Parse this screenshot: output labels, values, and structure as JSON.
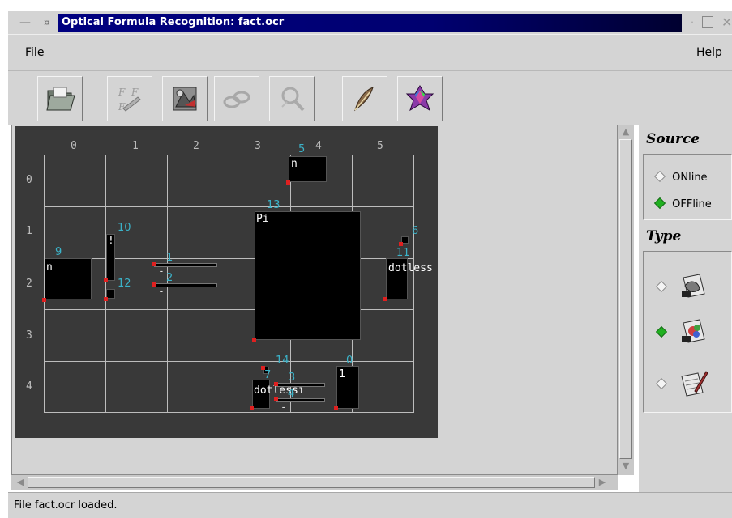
{
  "window": {
    "title": "Optical Formula Recognition: fact.ocr"
  },
  "menu": {
    "file": "File",
    "help": "Help"
  },
  "toolbar": {
    "buttons": [
      {
        "icon": "open-folder-icon"
      },
      {
        "icon": "formula-pencil-icon"
      },
      {
        "icon": "recognize-icon"
      },
      {
        "icon": "link-icon"
      },
      {
        "icon": "magnifier-icon"
      },
      {
        "icon": "feather-icon"
      },
      {
        "icon": "polyhedron-icon"
      }
    ]
  },
  "grid": {
    "columns": [
      "0",
      "1",
      "2",
      "3",
      "4",
      "5"
    ],
    "rows": [
      "0",
      "1",
      "2",
      "3",
      "4"
    ]
  },
  "glyphs": [
    {
      "id": "5",
      "label": "n"
    },
    {
      "id": "13",
      "label": "Pi"
    },
    {
      "id": "9",
      "label": "n"
    },
    {
      "id": "10",
      "label": "!"
    },
    {
      "id": "12",
      "label": ""
    },
    {
      "id": "1",
      "label": "-"
    },
    {
      "id": "2",
      "label": "-"
    },
    {
      "id": "6",
      "label": ""
    },
    {
      "id": "11",
      "label": "dotless"
    },
    {
      "id": "14",
      "label": ""
    },
    {
      "id": "7",
      "label": "dotlessi"
    },
    {
      "id": "3",
      "label": ""
    },
    {
      "id": "4",
      "label": "-"
    },
    {
      "id": "0",
      "label": "1"
    }
  ],
  "source": {
    "title": "Source",
    "options": [
      {
        "label": "ONline",
        "selected": false
      },
      {
        "label": "OFFline",
        "selected": true
      }
    ]
  },
  "type": {
    "title": "Type",
    "options": [
      {
        "icon": "ps-document-icon",
        "selected": false
      },
      {
        "icon": "image-document-icon",
        "selected": true
      },
      {
        "icon": "handwriting-icon",
        "selected": false
      }
    ]
  },
  "status": {
    "text": "File fact.ocr loaded."
  },
  "colors": {
    "canvas": "#393939",
    "grid": "#bdbdbd",
    "label": "#3bb3c9",
    "handle": "#e02020",
    "title_bar": "#000080"
  }
}
